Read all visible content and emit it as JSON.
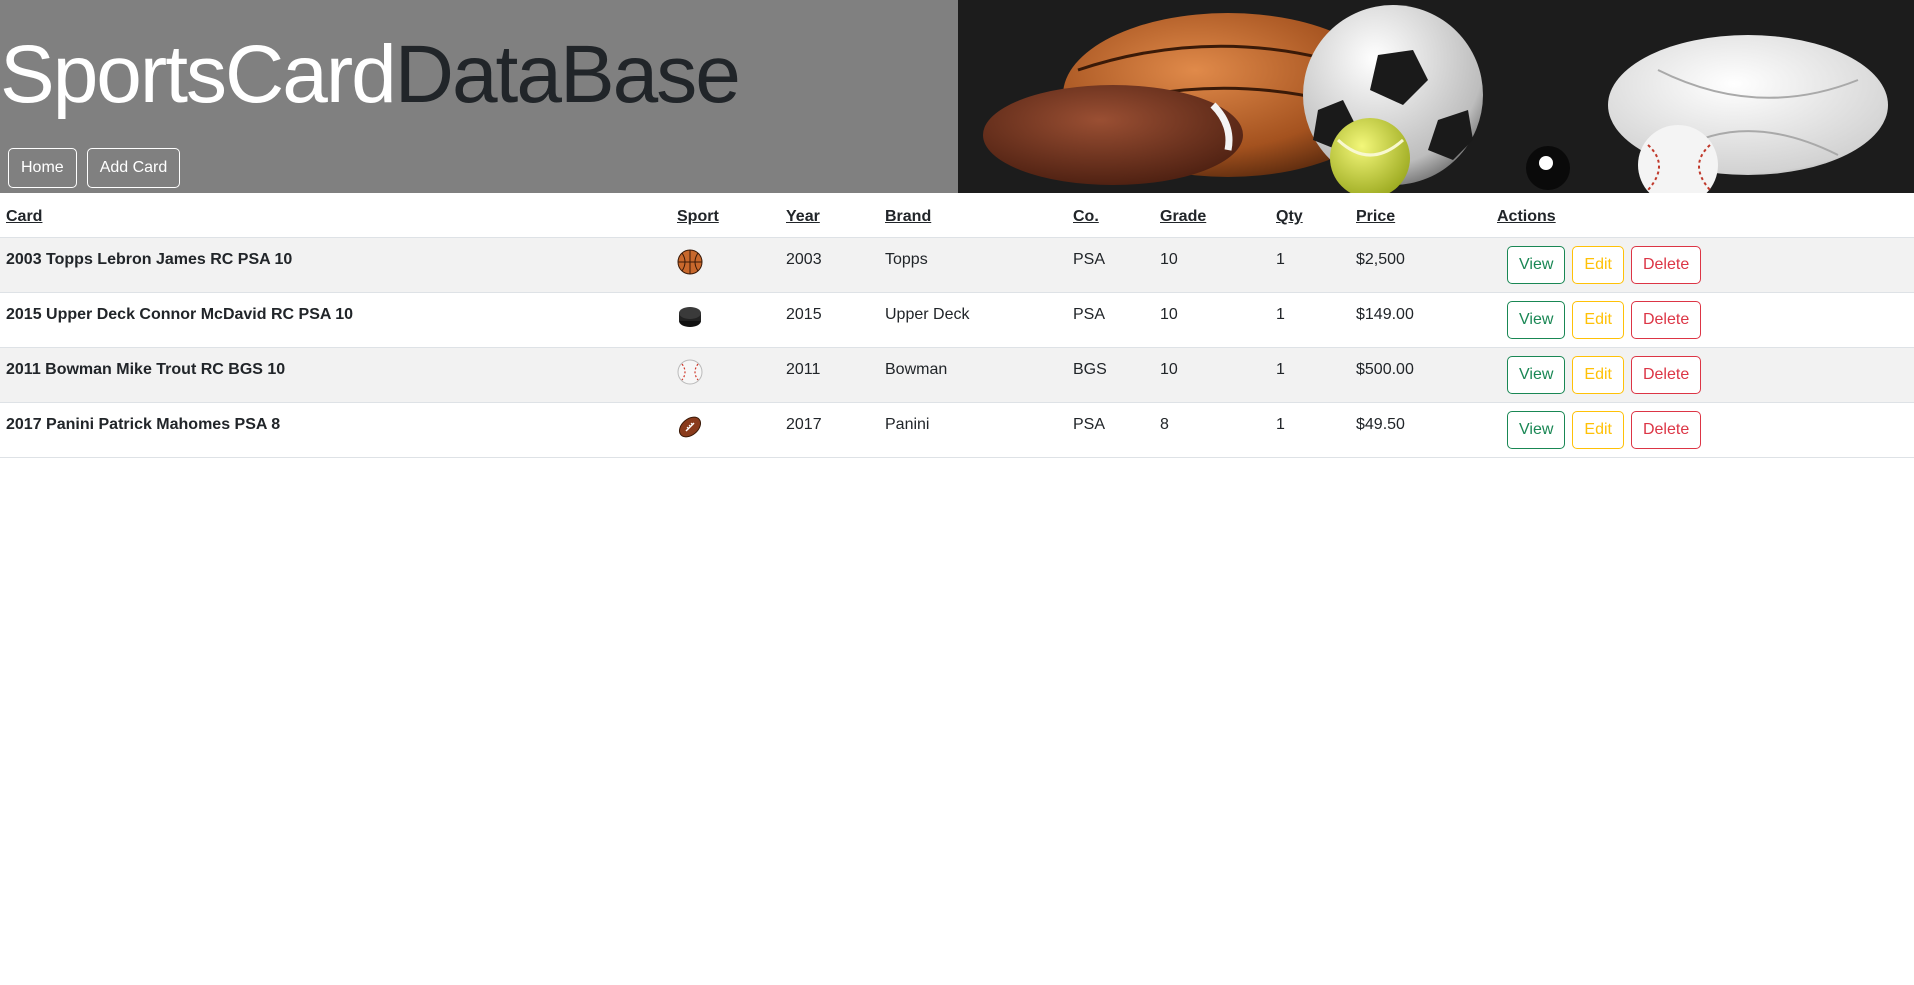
{
  "header": {
    "logo_part1": "SportsCard",
    "logo_part2": "DataBase",
    "nav": {
      "home": "Home",
      "add_card": "Add Card"
    },
    "banner_image": "sports-balls-image"
  },
  "table": {
    "columns": {
      "card": "Card",
      "sport": "Sport",
      "year": "Year",
      "brand": "Brand",
      "co": "Co.",
      "grade": "Grade",
      "qty": "Qty",
      "price": "Price",
      "actions": "Actions"
    },
    "actions": {
      "view": "View",
      "edit": "Edit",
      "delete": "Delete"
    },
    "rows": [
      {
        "card": "2003 Topps Lebron James RC PSA 10",
        "sport_icon": "basketball-icon",
        "year": "2003",
        "brand": "Topps",
        "co": "PSA",
        "grade": "10",
        "qty": "1",
        "price": "$2,500"
      },
      {
        "card": "2015 Upper Deck Connor McDavid RC PSA 10",
        "sport_icon": "hockey-puck-icon",
        "year": "2015",
        "brand": "Upper Deck",
        "co": "PSA",
        "grade": "10",
        "qty": "1",
        "price": "$149.00"
      },
      {
        "card": "2011 Bowman Mike Trout RC BGS 10",
        "sport_icon": "baseball-icon",
        "year": "2011",
        "brand": "Bowman",
        "co": "BGS",
        "grade": "10",
        "qty": "1",
        "price": "$500.00"
      },
      {
        "card": "2017 Panini Patrick Mahomes PSA 8",
        "sport_icon": "football-icon",
        "year": "2017",
        "brand": "Panini",
        "co": "PSA",
        "grade": "8",
        "qty": "1",
        "price": "$49.50"
      }
    ]
  },
  "colors": {
    "header_bg": "#808080",
    "banner_bg": "#1c1c1c",
    "view": "#198754",
    "edit": "#ffc107",
    "delete": "#dc3545"
  }
}
